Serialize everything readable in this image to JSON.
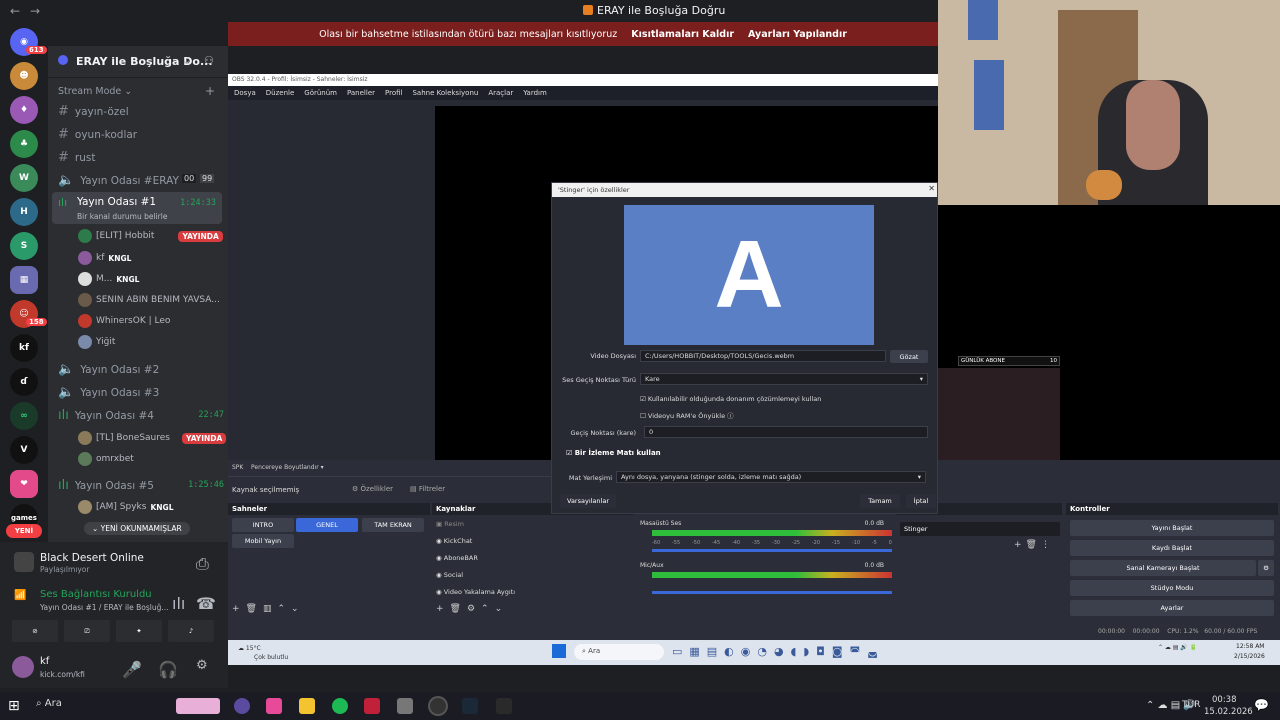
{
  "window": {
    "title": "ERAY ile Boşluğa Doğru"
  },
  "notice": {
    "text": "Olası bir bahsetme istilasından ötürü bazı mesajları kısıtlıyoruz",
    "action1": "Kısıtlamaları Kaldır",
    "action2": "Ayarları Yapılandır"
  },
  "guilds": {
    "badge_top": "613",
    "badge_mid": "158",
    "new_label": "YENİ"
  },
  "server": {
    "name": "ERAY ile Boşluğa Do...",
    "category": "Stream Mode",
    "channels": [
      {
        "name": "yayın-özel"
      },
      {
        "name": "oyun-kodlar"
      },
      {
        "name": "rust"
      }
    ],
    "voice1": {
      "name": "Yayın Odası #ERAY",
      "c1": "00",
      "c2": "99"
    },
    "voice2": {
      "name": "Yayın Odası #1",
      "time": "1:24:33",
      "status": "Bir kanal durumu belirle"
    },
    "voice2_users": [
      {
        "name": "[ELIT] Hobbit",
        "live": "YAYINDA"
      },
      {
        "name": "kf",
        "tag": "KNGL"
      },
      {
        "name": "M...",
        "tag": "KNGL"
      },
      {
        "name": "SENIN ABIN BENIM YAVSA..."
      },
      {
        "name": "WhinersOK | Leo"
      },
      {
        "name": "Yiğit"
      }
    ],
    "voice3": {
      "name": "Yayın Odası #2"
    },
    "voice4": {
      "name": "Yayın Odası #3"
    },
    "voice5": {
      "name": "Yayın Odası #4",
      "time": "22:47"
    },
    "voice5_users": [
      {
        "name": "[TL] BoneSaures",
        "live": "YAYINDA"
      },
      {
        "name": "omrxbet"
      }
    ],
    "voice6": {
      "name": "Yayın Odası #5",
      "time": "1:25:46"
    },
    "voice6_users": [
      {
        "name": "[AM] Spyks",
        "tag": "KNGL"
      }
    ],
    "unread": "YENİ OKUNMAMIŞLAR"
  },
  "activity": {
    "game": "Black Desert Online",
    "sub": "Paylaşılmıyor"
  },
  "voice_conn": {
    "title": "Ses Bağlantısı Kuruldu",
    "sub": "Yayın Odası #1 / ERAY ile Boşluğ..."
  },
  "user": {
    "name": "kf",
    "sub": "kick.com/kfi"
  },
  "obs": {
    "title": "OBS 32.0.4 - Profil: İsimsiz - Sahneler: İsimsiz",
    "menu": [
      "Dosya",
      "Düzenle",
      "Görünüm",
      "Paneller",
      "Profil",
      "Sahne Koleksiyonu",
      "Araçlar",
      "Yardım"
    ],
    "transition_row": {
      "spk": "SPK",
      "label": "Pencereye Boyutlandır"
    },
    "no_source": "Kaynak seçilmemiş",
    "props": "Özellikler",
    "filters": "Filtreler",
    "scenes_header": "Sahneler",
    "scenes": [
      "INTRO",
      "GENEL",
      "TAM EKRAN",
      "Mobil Yayın"
    ],
    "sources_header": "Kaynaklar",
    "sources": [
      "Resim",
      "KickChat",
      "AboneBAR",
      "Social",
      "Video Yakalama Aygıtı"
    ],
    "mixer": {
      "track1": "Masaüstü Ses",
      "db1": "0.0 dB",
      "track2": "Mic/Aux",
      "db2": "0.0 dB"
    },
    "ticks": [
      "-60",
      "-55",
      "-50",
      "-45",
      "-40",
      "-35",
      "-30",
      "-25",
      "-20",
      "-15",
      "-10",
      "-5",
      "0"
    ],
    "transitions_header": "geçişleri",
    "transition_sel": "Stinger",
    "controls_header": "Kontroller",
    "controls": [
      "Yayını Başlat",
      "Kaydı Başlat",
      "Sanal Kamerayı Başlat",
      "Stüdyo Modu",
      "Ayarlar"
    ],
    "status": {
      "t1": "00:00:00",
      "t2": "00:00:00",
      "cpu": "CPU: 1.2%",
      "fps": "60.00 / 60.00 FPS"
    },
    "overlay_label": "GÜNLÜK ABONE",
    "overlay_value": "10"
  },
  "dialog": {
    "title": "'Stinger' için özellikler",
    "preview_letter": "A",
    "video_label": "Video Dosyası",
    "video_value": "C:/Users/HOBBIT/Desktop/TOOLS/Gecis.webm",
    "browse": "Gözat",
    "point_type_label": "Ses Geçiş Noktası Türü",
    "point_type_value": "Kare",
    "hw_decode": "Kullanılabilir olduğunda donanım çözümlemeyi kullan",
    "preload": "Videoyu RAM'e Önyükle",
    "point_label": "Geçiş Noktası (kare)",
    "point_value": "0",
    "track_matte": "Bir İzleme Matı kullan",
    "matte_label": "Mat Yerleşimi",
    "matte_value": "Aynı dosya, yanyana (stinger solda, izleme matı sağda)",
    "defaults": "Varsayılanlar",
    "ok": "Tamam",
    "cancel": "İptal"
  },
  "inner_taskbar": {
    "weather": "15°C",
    "weather_sub": "Çok bulutlu",
    "search": "Ara",
    "time": "12:58 AM",
    "date": "2/15/2026"
  },
  "taskbar": {
    "search": "Ara",
    "lang": "TUR",
    "time": "00:38",
    "date": "15.02.2026"
  }
}
